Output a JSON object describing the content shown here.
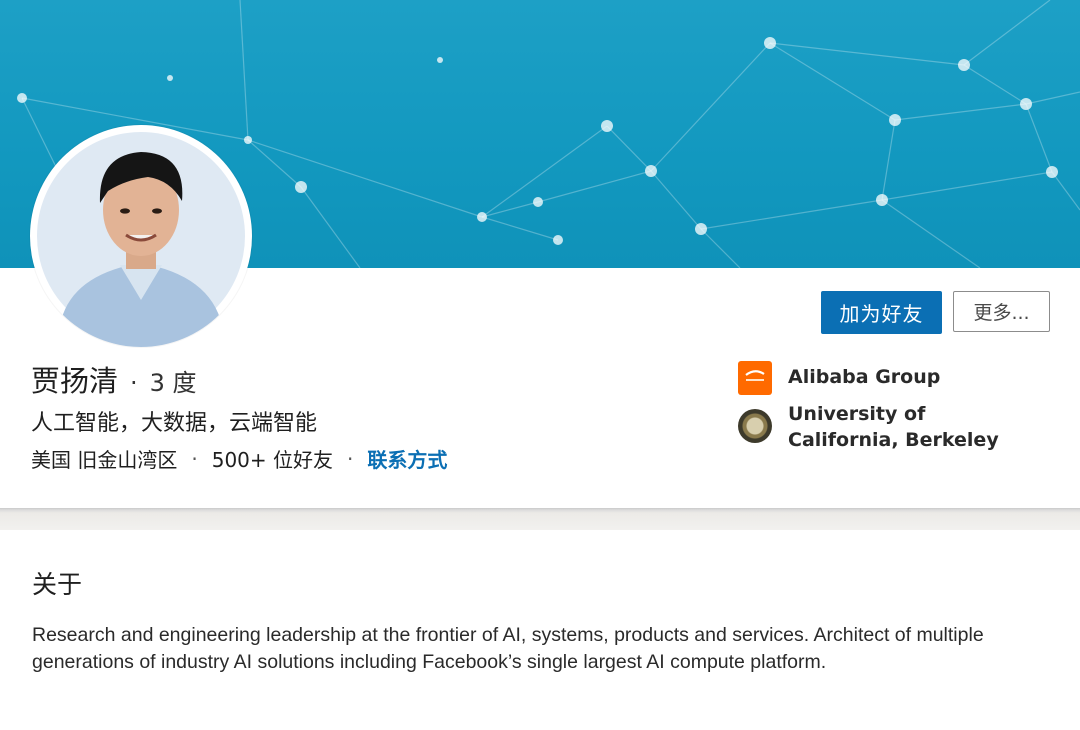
{
  "profile": {
    "name": "贾扬清",
    "separator": "·",
    "degree": "3 度",
    "headline": "人工智能，大数据，云端智能",
    "location": "美国 旧金山湾区",
    "connections": "500+ 位好友",
    "contact_link": "联系方式"
  },
  "actions": {
    "connect_label": "加为好友",
    "more_label": "更多..."
  },
  "organizations": {
    "company": "Alibaba Group",
    "school": "University of California, Berkeley"
  },
  "about": {
    "title": "关于",
    "body": "Research and engineering leadership at the frontier of AI, systems, products and services. Architect of multiple generations of industry AI solutions including Facebook’s single largest AI compute platform."
  },
  "colors": {
    "banner": "#1298bf",
    "primary_button": "#0b6fb4",
    "link": "#0b6fb4",
    "alibaba_logo": "#ff6a00"
  },
  "icons": {
    "company_logo": "alibaba-logo-icon",
    "school_logo": "berkeley-seal-icon"
  }
}
